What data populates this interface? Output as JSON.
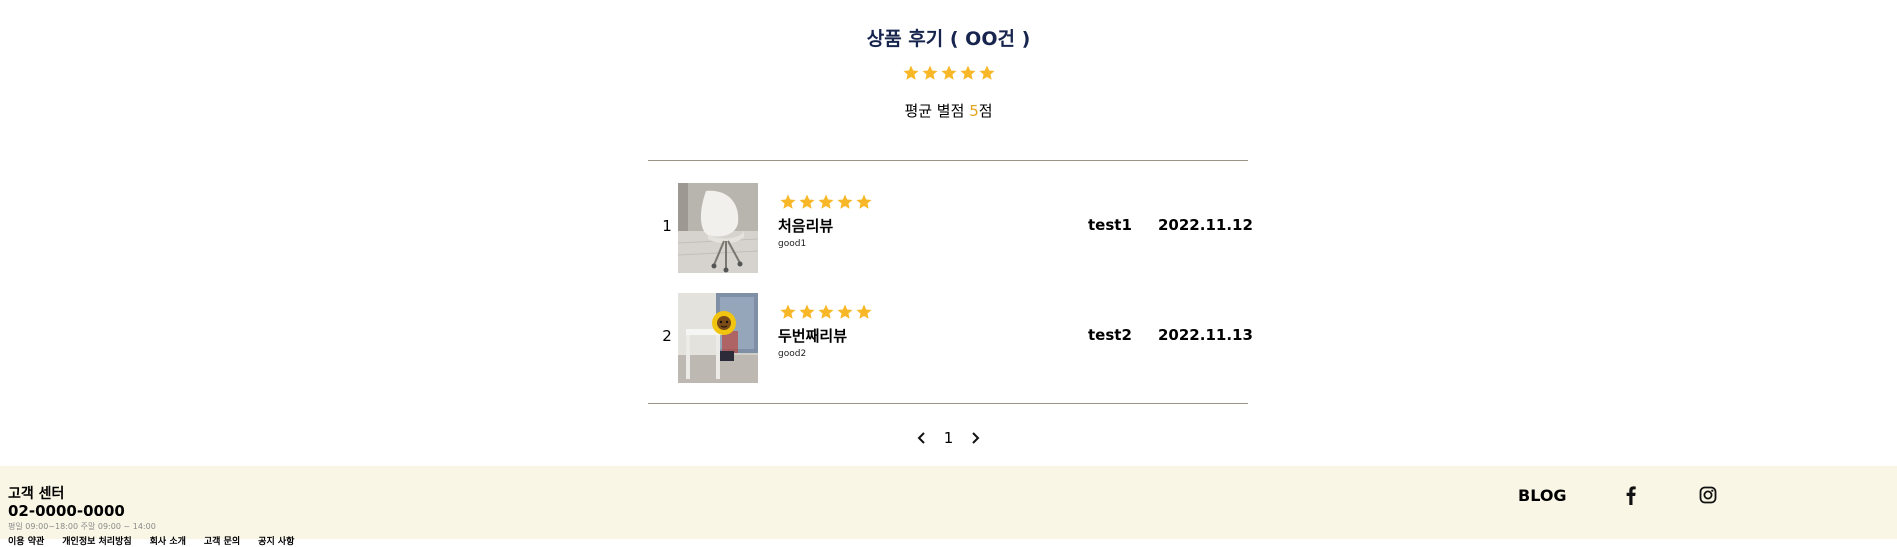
{
  "header": {
    "title": "상품 후기 ( OO건 )",
    "average_prefix": "평균 별점 ",
    "average_score": "5",
    "average_suffix": "점",
    "rating": 5
  },
  "reviews": [
    {
      "num": "1",
      "rating": 5,
      "title": "처음리뷰",
      "body": "good1",
      "user": "test1",
      "date": "2022.11.12",
      "photo": "white-chair-photo"
    },
    {
      "num": "2",
      "rating": 5,
      "title": "두번째리뷰",
      "body": "good2",
      "user": "test2",
      "date": "2022.11.13",
      "photo": "child-desk-photo"
    }
  ],
  "pagination": {
    "prev_icon": "chevron-left-icon",
    "page": "1",
    "next_icon": "chevron-right-icon"
  },
  "footer": {
    "title": "고객 센터",
    "phone": "02-0000-0000",
    "hours": "평일 09:00~18:00 주말 09:00 ~ 14:00",
    "links": [
      "이용 약관",
      "개인정보 처리방침",
      "회사 소개",
      "고객 문의",
      "공지 사항"
    ],
    "blog": "BLOG",
    "social": [
      "facebook-icon",
      "instagram-icon"
    ]
  },
  "colors": {
    "star": "#f7b727",
    "accent": "#e5a51d",
    "heading": "#17254e",
    "footer_bg": "#f9f6e5",
    "divider": "#9a9585"
  }
}
